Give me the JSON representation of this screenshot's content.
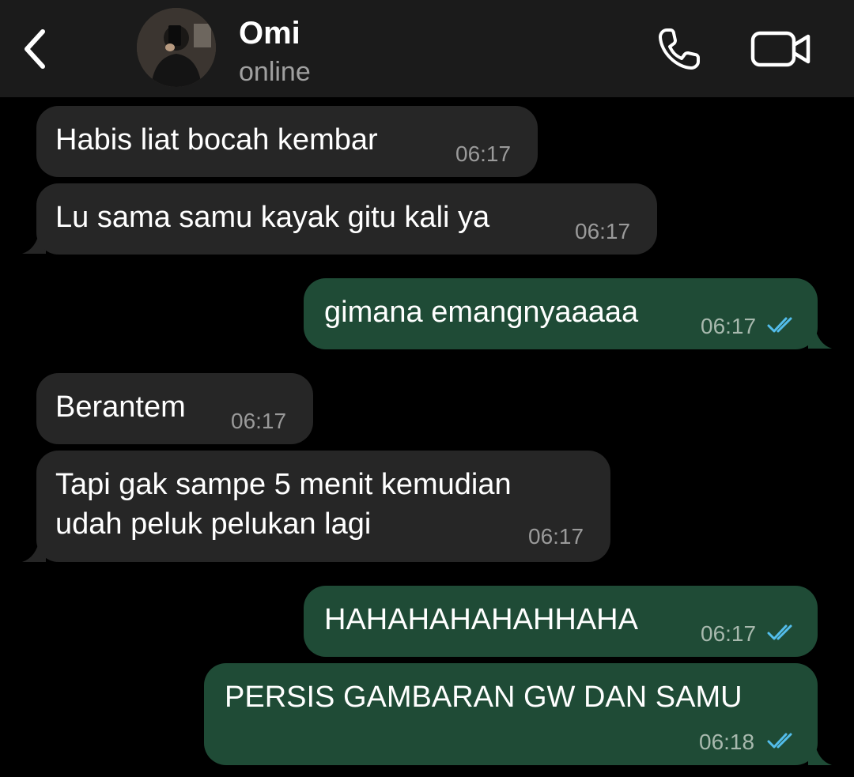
{
  "header": {
    "back_icon": "chevron-left-icon",
    "contact_name": "Omi",
    "contact_status": "online",
    "call_icon": "phone-icon",
    "video_icon": "video-camera-icon"
  },
  "colors": {
    "header_bg": "#1b1b1b",
    "chat_bg": "#000000",
    "incoming_bubble": "#262626",
    "outgoing_bubble": "#1f4b36",
    "read_ticks": "#53bdeb",
    "status_text": "#a0a0a0"
  },
  "messages": [
    {
      "direction": "incoming",
      "lines": [
        "Habis liat bocah kembar"
      ],
      "time": "06:17"
    },
    {
      "direction": "incoming",
      "lines": [
        "Lu sama samu kayak gitu kali ya"
      ],
      "time": "06:17"
    },
    {
      "direction": "outgoing",
      "lines": [
        "gimana emangnyaaaaa"
      ],
      "time": "06:17",
      "status": "read"
    },
    {
      "direction": "incoming",
      "lines": [
        "Berantem"
      ],
      "time": "06:17"
    },
    {
      "direction": "incoming",
      "lines": [
        "Tapi gak sampe 5 menit kemudian",
        "udah peluk pelukan lagi"
      ],
      "time": "06:17"
    },
    {
      "direction": "outgoing",
      "lines": [
        "HAHAHAHAHAHHAHA"
      ],
      "time": "06:17",
      "status": "read"
    },
    {
      "direction": "outgoing",
      "lines": [
        "PERSIS GAMBARAN GW DAN SAMU"
      ],
      "time": "06:18",
      "status": "read"
    }
  ]
}
